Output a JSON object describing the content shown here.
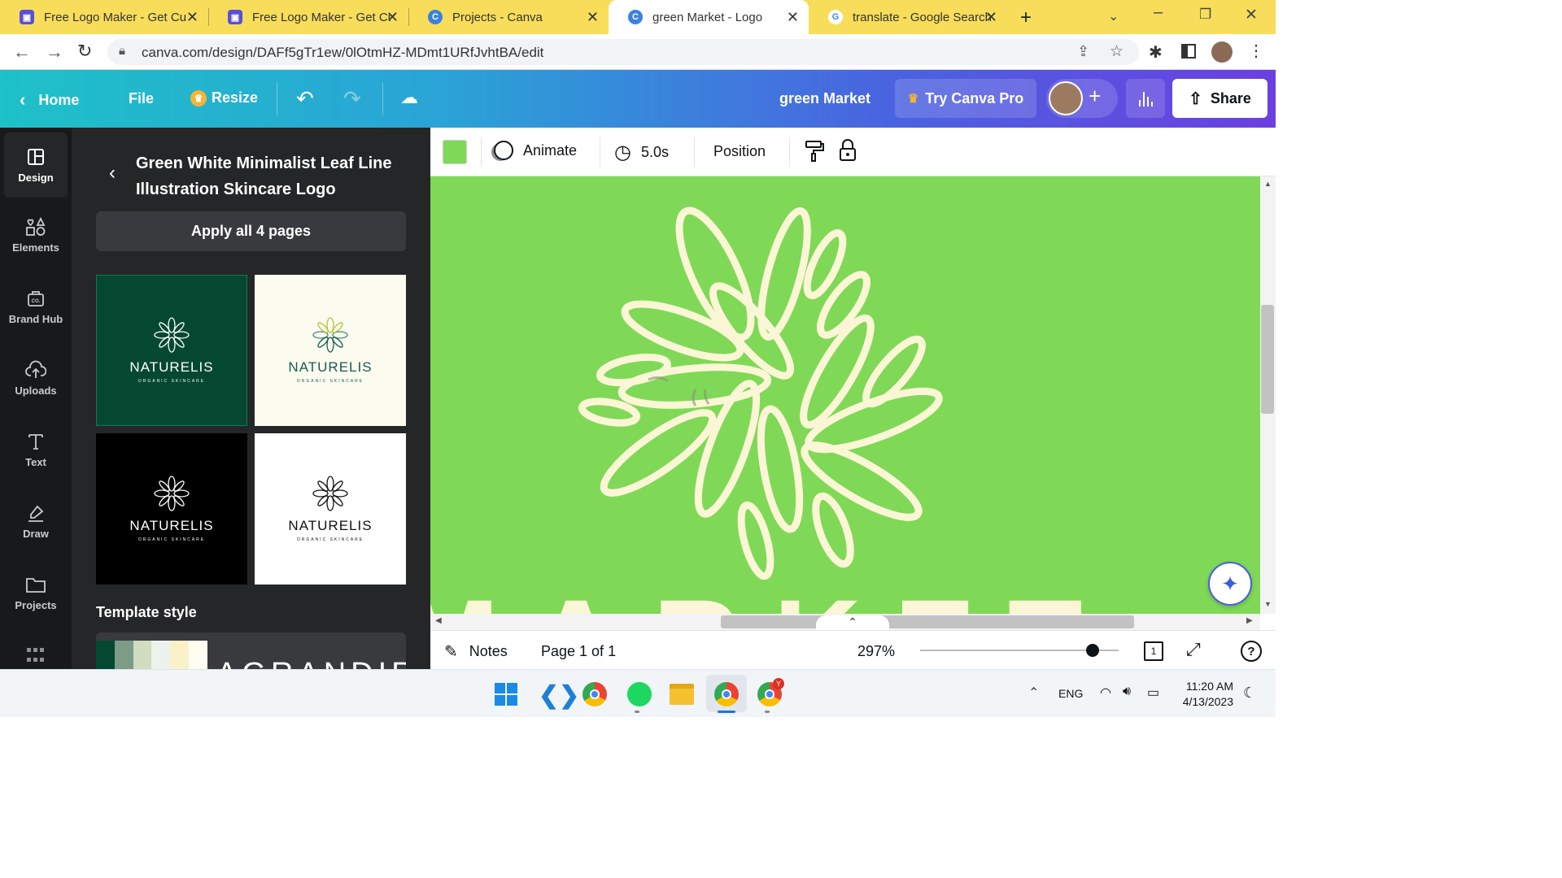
{
  "browser": {
    "tabs": [
      {
        "title": "Free Logo Maker - Get Cu",
        "favicon": "logo-maker-favicon"
      },
      {
        "title": "Free Logo Maker - Get Cu",
        "favicon": "logo-maker-favicon"
      },
      {
        "title": "Projects - Canva",
        "favicon": "canva-favicon"
      },
      {
        "title": "green Market - Logo",
        "favicon": "canva-favicon",
        "active": true
      },
      {
        "title": "translate - Google Search",
        "favicon": "google-favicon"
      }
    ],
    "url": "canva.com/design/DAFf5gTr1ew/0lOtmHZ-MDmt1URfJvhtBA/edit"
  },
  "header": {
    "home": "Home",
    "file": "File",
    "resize": "Resize",
    "doc_title": "green Market",
    "try_pro": "Try Canva Pro",
    "share": "Share"
  },
  "rail": [
    {
      "label": "Design",
      "icon": "layout-icon"
    },
    {
      "label": "Elements",
      "icon": "shapes-icon"
    },
    {
      "label": "Brand Hub",
      "icon": "brand-icon"
    },
    {
      "label": "Uploads",
      "icon": "cloud-upload-icon"
    },
    {
      "label": "Text",
      "icon": "text-icon"
    },
    {
      "label": "Draw",
      "icon": "pen-icon"
    },
    {
      "label": "Projects",
      "icon": "folder-icon"
    }
  ],
  "panel": {
    "title_line1": "Green White Minimalist Leaf Line",
    "title_line2": "Illustration Skincare Logo",
    "apply_all": "Apply all 4 pages",
    "template_brand": "NATURELIS",
    "template_tag": "ORGANIC SKINCARE",
    "template_style_heading": "Template style",
    "style_preview_text": "AGRANDIR"
  },
  "toolbar": {
    "color_hex": "#7fd957",
    "animate": "Animate",
    "duration": "5.0s",
    "position": "Position"
  },
  "canvas": {
    "bg": "#7fd957",
    "leaf_color": "#fbf6d6",
    "partial_text": "MARKET"
  },
  "bottom": {
    "notes": "Notes",
    "page": "Page 1 of 1",
    "zoom": "297%",
    "page_count": "1"
  },
  "taskbar": {
    "lang": "ENG",
    "time": "11:20 AM",
    "date": "4/13/2023"
  }
}
